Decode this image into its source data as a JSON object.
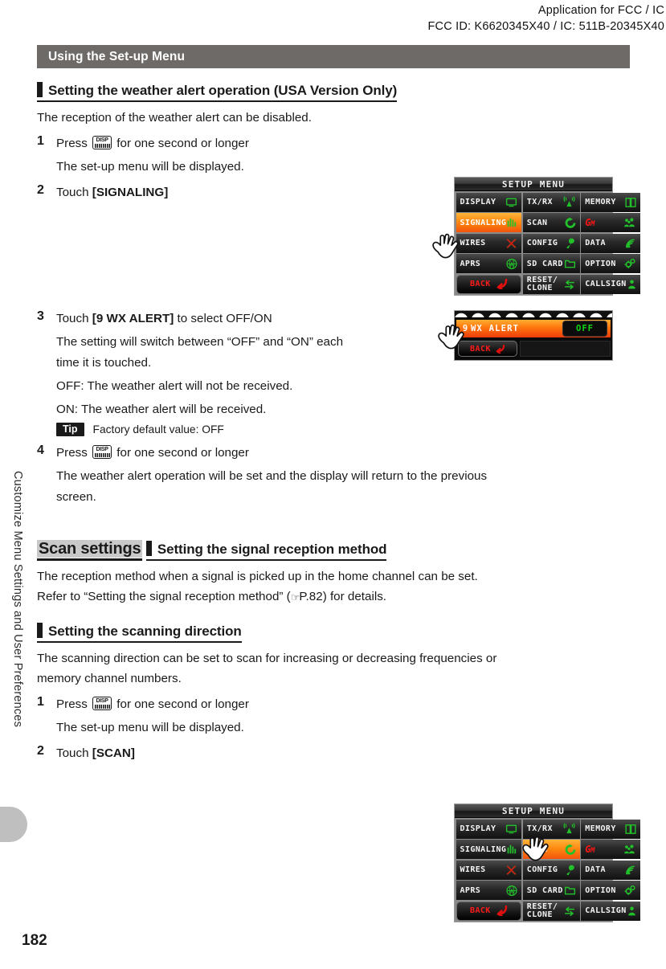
{
  "header": {
    "line1": "Application for FCC / IC",
    "line2": "FCC ID: K6620345X40 / IC: 511B-20345X40"
  },
  "sidebar": {
    "vertical_label": "Customize Menu Settings and User Preferences",
    "page_number": "182"
  },
  "chapter_bar": {
    "title": "Using the Set-up Menu"
  },
  "section1": {
    "heading": "Setting the weather alert operation (USA Version Only)",
    "intro": "The reception of the weather alert can be disabled.",
    "step1_num": "1",
    "step1_pre": "Press",
    "step1_post": "for one second or longer",
    "step1_sub": "The set-up menu will be displayed.",
    "step2_num": "2",
    "step2_pre": "Touch",
    "step2_bold": "[SIGNALING]",
    "step3_num": "3",
    "step3_pre": "Touch",
    "step3_bold": "[9 WX ALERT]",
    "step3_post": "to select OFF/ON",
    "step3_sub1": "The setting will switch between “OFF” and “ON” each",
    "step3_sub2": "time it is touched.",
    "step3_off": "OFF: The weather alert will not be received.",
    "step3_on": "ON:  The weather alert will be received.",
    "tip_label": "Tip",
    "tip_text": "Factory default value: OFF",
    "step4_num": "4",
    "step4_pre": "Press",
    "step4_post": "for one second or longer",
    "step4_sub1": "The weather alert operation will be set and the display will return to the previous",
    "step4_sub2": "screen."
  },
  "chapter2": {
    "title": "Scan settings"
  },
  "section2": {
    "heading": "Setting the signal reception method",
    "line1": "The reception method when a signal is picked up in the home channel can be set.",
    "line2_a": "Refer to “Setting the signal reception method” (",
    "line2_ref": "P.82",
    "line2_b": ") for details."
  },
  "section3": {
    "heading": "Setting the scanning direction",
    "line1": "The scanning direction can be set to scan for increasing or decreasing frequencies or",
    "line2": "memory channel numbers.",
    "step1_num": "1",
    "step1_pre": "Press",
    "step1_post": "for one second or longer",
    "step1_sub": "The set-up menu will be displayed.",
    "step2_num": "2",
    "step2_pre": "Touch",
    "step2_bold": "[SCAN]"
  },
  "lcd_setup_menu": {
    "title": "SETUP MENU",
    "cells": [
      {
        "label": "DISPLAY",
        "icon": "monitor-icon",
        "highlight": false
      },
      {
        "label": "TX/RX",
        "icon": "antenna-icon",
        "highlight": false
      },
      {
        "label": "MEMORY",
        "icon": "book-icon",
        "highlight": false
      },
      {
        "label": "SIGNALING",
        "icon": "bars-icon",
        "highlight": true
      },
      {
        "label": "SCAN",
        "icon": "refresh-icon",
        "highlight": false
      },
      {
        "label": "GM",
        "icon": "people-icon",
        "highlight": false
      },
      {
        "label": "WIRES",
        "icon": "wires-x-icon",
        "highlight": false
      },
      {
        "label": "CONFIG",
        "icon": "wrench-icon",
        "highlight": false
      },
      {
        "label": "DATA",
        "icon": "signal-icon",
        "highlight": false
      },
      {
        "label": "APRS",
        "icon": "globe-a-icon",
        "highlight": false
      },
      {
        "label": "SD CARD",
        "icon": "folder-icon",
        "highlight": false
      },
      {
        "label": "OPTION",
        "icon": "gears-icon",
        "highlight": false
      },
      {
        "label": "BACK",
        "icon": "back-arrow-icon",
        "highlight": false
      },
      {
        "label": "RESET/\nCLONE",
        "icon": "swap-icon",
        "highlight": false
      },
      {
        "label": "CALLSIGN",
        "icon": "person-icon",
        "highlight": false
      }
    ],
    "colors": {
      "highlight": "#ff8a12",
      "label": "#f4f4f4",
      "back_label": "#ff1a1a",
      "icon_green": "#22c02a"
    }
  },
  "lcd_setup_menu_2": {
    "cells": [
      {
        "label": "DISPLAY",
        "icon": "monitor-icon",
        "highlight": false
      },
      {
        "label": "TX/RX",
        "icon": "antenna-icon",
        "highlight": false
      },
      {
        "label": "MEMORY",
        "icon": "book-icon",
        "highlight": false
      },
      {
        "label": "SIGNALING",
        "icon": "bars-icon",
        "highlight": false
      },
      {
        "label": "SCAN",
        "icon": "refresh-icon",
        "highlight": true
      },
      {
        "label": "GM",
        "icon": "people-icon",
        "highlight": false
      },
      {
        "label": "WIRES",
        "icon": "wires-x-icon",
        "highlight": false
      },
      {
        "label": "CONFIG",
        "icon": "wrench-icon",
        "highlight": false
      },
      {
        "label": "DATA",
        "icon": "signal-icon",
        "highlight": false
      },
      {
        "label": "APRS",
        "icon": "globe-a-icon",
        "highlight": false
      },
      {
        "label": "SD CARD",
        "icon": "folder-icon",
        "highlight": false
      },
      {
        "label": "OPTION",
        "icon": "gears-icon",
        "highlight": false
      },
      {
        "label": "BACK",
        "icon": "back-arrow-icon",
        "highlight": false
      },
      {
        "label": "RESET/\nCLONE",
        "icon": "swap-icon",
        "highlight": false
      },
      {
        "label": "CALLSIGN",
        "icon": "person-icon",
        "highlight": false
      }
    ]
  },
  "lcd_wx_alert": {
    "row_number": "9",
    "row_label": "WX ALERT",
    "row_value": "OFF",
    "back_label": "BACK"
  }
}
